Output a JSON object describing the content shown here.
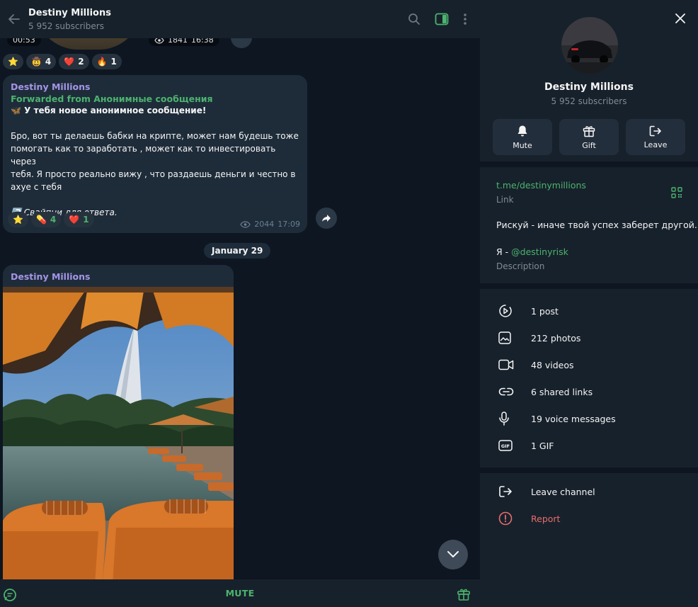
{
  "header": {
    "title": "Destiny Millions",
    "subtitle": "5 952 subscribers"
  },
  "top_message": {
    "duration": "00:53",
    "views": "1841",
    "time": "16:38",
    "reactions": [
      {
        "emoji": "⭐",
        "count": ""
      },
      {
        "emoji": "🤠",
        "count": "4"
      },
      {
        "emoji": "❤️",
        "count": "2"
      },
      {
        "emoji": "🔥",
        "count": "1"
      }
    ]
  },
  "message1": {
    "author": "Destiny Millions",
    "forwarded": "Forwarded from Анонимные сообщения",
    "headline_emoji": "🦋",
    "headline": "У тебя новое анонимное сообщение!",
    "body_lines": [
      "Бро, вот ты делаешь бабки на крипте, может нам будешь тоже",
      "помогать как то заработать , может как то инвестировать через",
      "тебя. Я просто реально вижу , что раздаешь деньги и честно в",
      "ахуе с тебя"
    ],
    "footer_emoji": "↩️",
    "footer": "Свайпни для ответа.",
    "reactions": [
      {
        "emoji": "⭐",
        "count": ""
      },
      {
        "emoji": "💊",
        "count": "4"
      },
      {
        "emoji": "❤️",
        "count": "1"
      }
    ],
    "views": "2044",
    "time": "17:09"
  },
  "date_separator": "January 29",
  "message2": {
    "author": "Destiny Millions"
  },
  "bottom_bar": {
    "mute_label": "MUTE"
  },
  "panel": {
    "name": "Destiny Millions",
    "subscribers": "5 952 subscribers",
    "actions": [
      {
        "label": "Mute",
        "icon": "bell-icon"
      },
      {
        "label": "Gift",
        "icon": "gift-icon"
      },
      {
        "label": "Leave",
        "icon": "leave-icon"
      }
    ],
    "link": "t.me/destinymillions",
    "link_caption": "Link",
    "description_line1": "Рискуй - иначе твой успех заберет другой.",
    "description_prefix": "Я - ",
    "description_handle": "@destinyrisk",
    "description_caption": "Description",
    "media": [
      {
        "label": "1 post",
        "icon": "post-icon"
      },
      {
        "label": "212 photos",
        "icon": "photo-icon"
      },
      {
        "label": "48 videos",
        "icon": "video-icon"
      },
      {
        "label": "6 shared links",
        "icon": "link-icon"
      },
      {
        "label": "19 voice messages",
        "icon": "mic-icon"
      },
      {
        "label": "1 GIF",
        "icon": "gif-icon"
      }
    ],
    "leave_channel": "Leave channel",
    "report": "Report"
  },
  "colors": {
    "accent_green": "#4cb36e",
    "author_purple": "#a695e7",
    "report_red": "#e56d6d",
    "panel_bg": "#17212b",
    "chat_bg": "#0e1621"
  }
}
